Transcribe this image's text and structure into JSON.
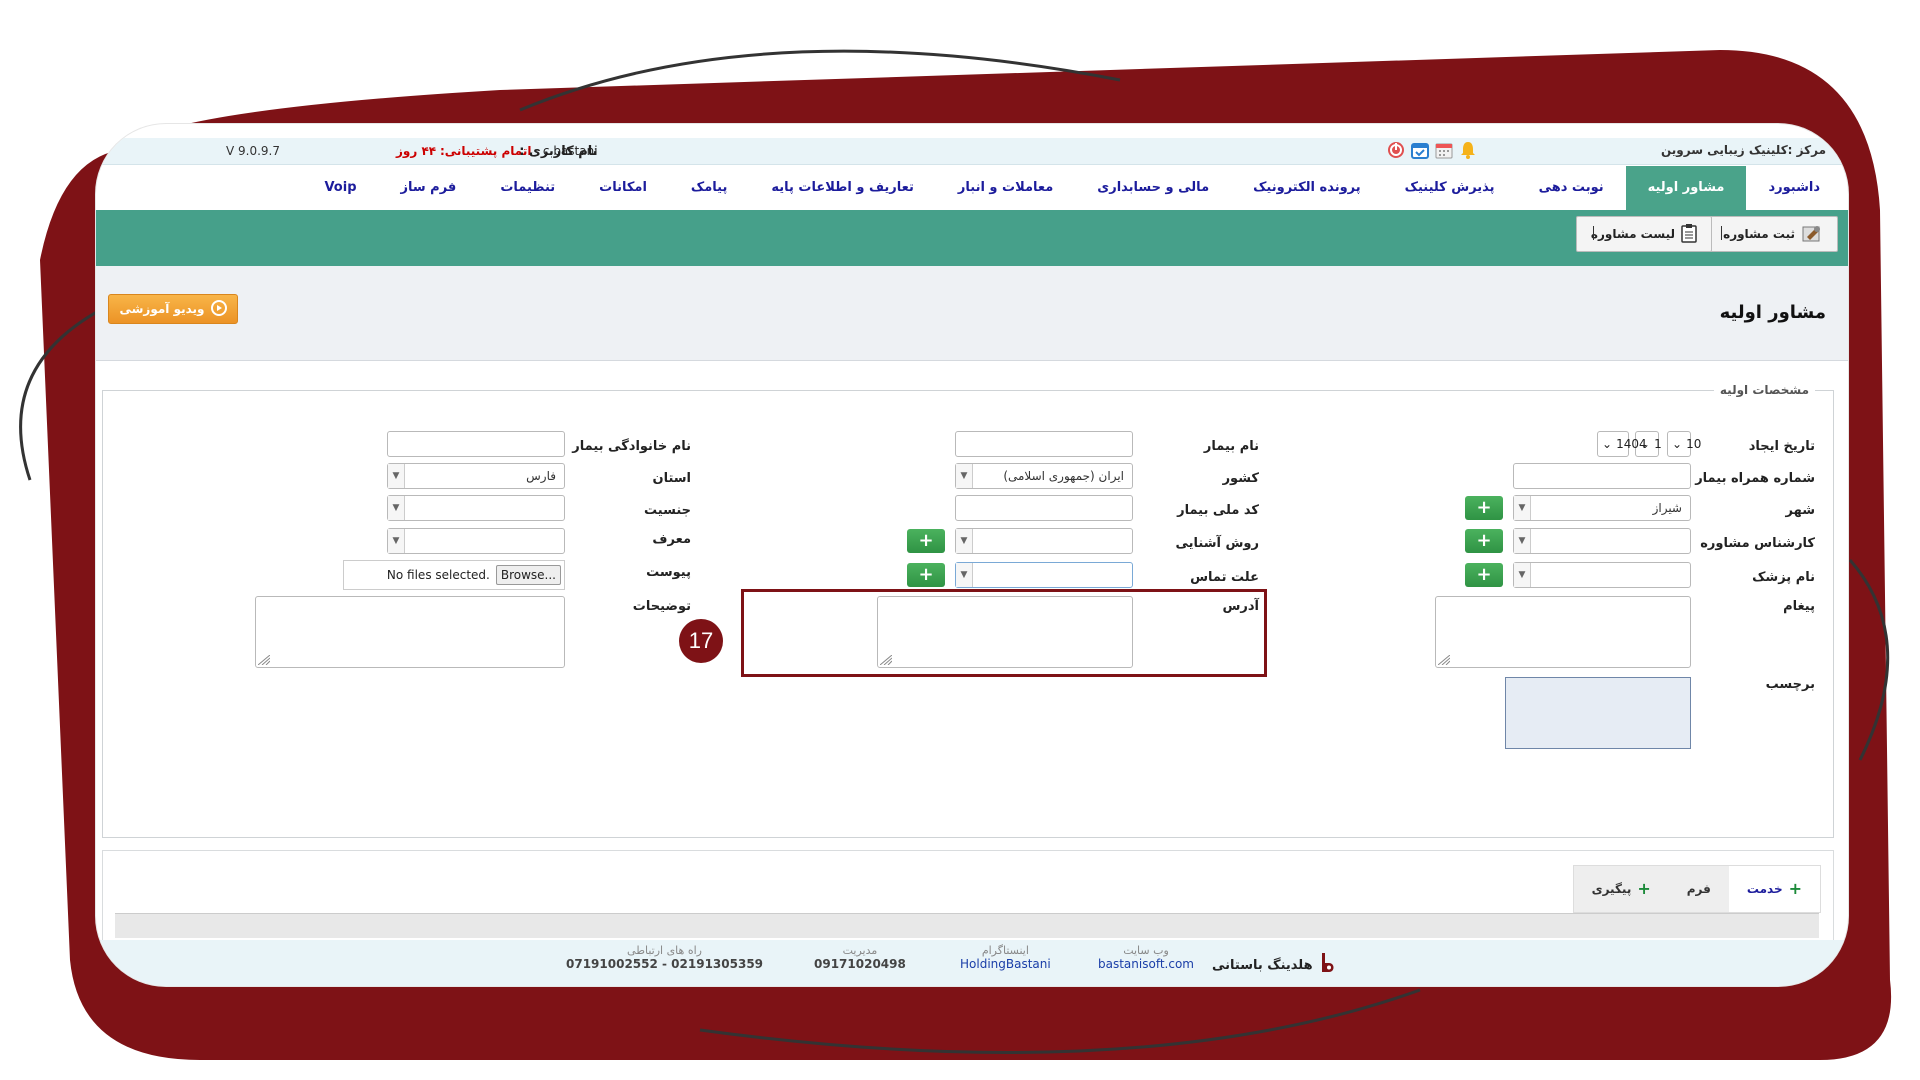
{
  "topbar": {
    "clinic_name": "مرکز :کلینیک زیبایی سروین",
    "user_label": "نام کاربری :",
    "user_name": "c.bastani",
    "support_label": "اتمام پشتیبانی:",
    "support_value": "۴۴ روز",
    "version": "V 9.0.9.7",
    "icons": [
      "power-icon",
      "calendar-check-icon",
      "calendar-icon",
      "bell-icon"
    ]
  },
  "nav": {
    "items": [
      {
        "label": "داشبورد",
        "active": false
      },
      {
        "label": "مشاور اولیه",
        "active": true
      },
      {
        "label": "نوبت دهی",
        "active": false
      },
      {
        "label": "پذیرش کلینیک",
        "active": false
      },
      {
        "label": "پرونده الکترونیک",
        "active": false
      },
      {
        "label": "مالی و حسابداری",
        "active": false
      },
      {
        "label": "معاملات و انبار",
        "active": false
      },
      {
        "label": "تعاریف و اطلاعات پایه",
        "active": false
      },
      {
        "label": "پیامک",
        "active": false
      },
      {
        "label": "امکانات",
        "active": false
      },
      {
        "label": "تنظیمات",
        "active": false
      },
      {
        "label": "فرم ساز",
        "active": false
      },
      {
        "label": "Voip",
        "active": false
      }
    ]
  },
  "toolbar": {
    "register_label": "ثبت مشاوره",
    "list_label": "لیست مشاوره"
  },
  "header": {
    "title": "مشاور اولیه",
    "video_label": "ویدیو آموزشی"
  },
  "form": {
    "legend": "مشخصات اولیه",
    "labels": {
      "created_date": "تاریخ ایجاد",
      "patient_name": "نام بیمار",
      "family_name": "نام خانوادگی بیمار",
      "mobile": "شماره همراه بیمار",
      "country": "کشور",
      "province": "استان",
      "city": "شهر",
      "national_code": "کد ملی بیمار",
      "gender": "جنسیت",
      "consultant": "کارشناس مشاوره",
      "acquaintance": "روش آشنایی",
      "referrer": "معرف",
      "doctor": "نام پزشک",
      "contact_reason": "علت تماس",
      "attachment": "پیوست",
      "message": "پیغام",
      "address": "آدرس",
      "description": "توضیحات",
      "tag": "برچسب"
    },
    "values": {
      "date_day": "10",
      "date_month": "1",
      "date_year": "1404",
      "country": "ایران (جمهوری اسلامی)",
      "province": "فارس",
      "city": "شیراز",
      "file_status": "No files selected.",
      "browse_label": "Browse..."
    },
    "annotation_number": "17",
    "annotation_color": "#7e1216"
  },
  "bottom_tabs": [
    {
      "label": "خدمت",
      "active": true,
      "plus": true
    },
    {
      "label": "فرم",
      "active": false,
      "plus": false
    },
    {
      "label": "پیگیری",
      "active": false,
      "plus": true
    }
  ],
  "footer": {
    "brand": "هلدینگ باستانی",
    "website_caption": "وب سایت",
    "website": "bastanisoft.com",
    "instagram_caption": "اینستاگرام",
    "instagram": "HoldingBastani",
    "management_caption": "مدیریت",
    "management_phone": "09171020498",
    "contact_caption": "راه های ارتباطی",
    "contact_phones": "07191002552 - 02191305359"
  },
  "colors": {
    "frame": "#7e1216",
    "accent_green": "#46a08a",
    "nav_text": "#1c1c9c"
  }
}
